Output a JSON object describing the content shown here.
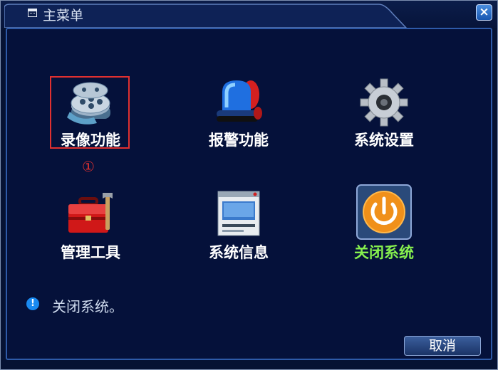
{
  "window": {
    "title": "主菜单",
    "close_label": "×"
  },
  "menu": {
    "items": [
      {
        "label": "录像功能"
      },
      {
        "label": "报警功能"
      },
      {
        "label": "系统设置"
      },
      {
        "label": "管理工具"
      },
      {
        "label": "系统信息"
      },
      {
        "label": "关闭系统"
      }
    ],
    "marker": "①"
  },
  "status": {
    "message": "关闭系统。"
  },
  "footer": {
    "cancel_label": "取消"
  },
  "colors": {
    "background": "#05113a",
    "active_label": "#86f04e",
    "highlight_border": "#e03030"
  }
}
